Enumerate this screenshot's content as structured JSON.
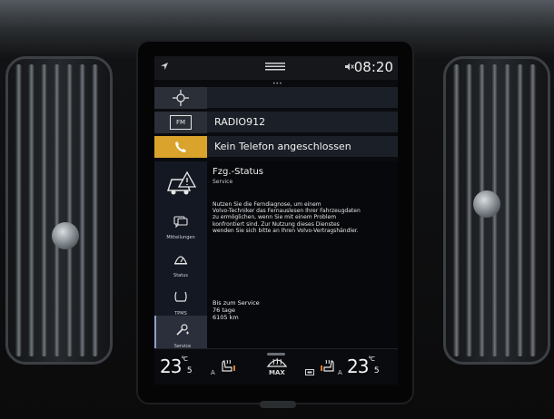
{
  "status_bar": {
    "time": "08:20",
    "icons": [
      "location-arrow-icon",
      "menu-handle-icon",
      "mute-icon"
    ]
  },
  "tiles": [
    {
      "icon": "navigation-crosshair-icon",
      "label": ""
    },
    {
      "icon": "fm-radio-icon",
      "icon_text": "FM",
      "label": "RADIO912"
    },
    {
      "icon": "phone-icon",
      "label": "Kein Telefon angeschlossen"
    }
  ],
  "app": {
    "icon": "car-warning-icon",
    "title": "Fzg.-Status",
    "subtitle": "Service",
    "message_lines": [
      "Nutzen Sie die Ferndiagnose, um einem",
      "Volvo-Techniker das Fernauslesen Ihrer Fahrzeugdaten",
      "zu ermöglichen, wenn Sie mit einem Problem",
      "konfrontiert sind. Zur Nutzung dieses Dienstes",
      "wenden Sie sich bitte an Ihren Volvo-Vertragshändler."
    ],
    "sidebar": [
      {
        "icon": "message-icon",
        "label": "Mitteilungen",
        "active": false
      },
      {
        "icon": "status-icon",
        "label": "Status",
        "active": false
      },
      {
        "icon": "tpms-icon",
        "label": "TPMS",
        "active": false
      },
      {
        "icon": "service-wrench-icon",
        "label": "Service",
        "active": true
      }
    ],
    "service": {
      "heading": "Bis zum Service",
      "days": "76 tage",
      "distance": "6105 km"
    }
  },
  "climate": {
    "left_temp": "23",
    "left_temp_unit": "°C",
    "left_temp_decimal": "5",
    "left_mode": "A",
    "right_temp": "23",
    "right_temp_unit": "°C",
    "right_temp_decimal": "5",
    "right_mode": "A",
    "defrost_label": "MAX"
  },
  "colors": {
    "phone_tile_accent": "#d9a32c",
    "screen_bg": "#0a0b0e",
    "seat_heat_indicator": "#e07a2a"
  }
}
